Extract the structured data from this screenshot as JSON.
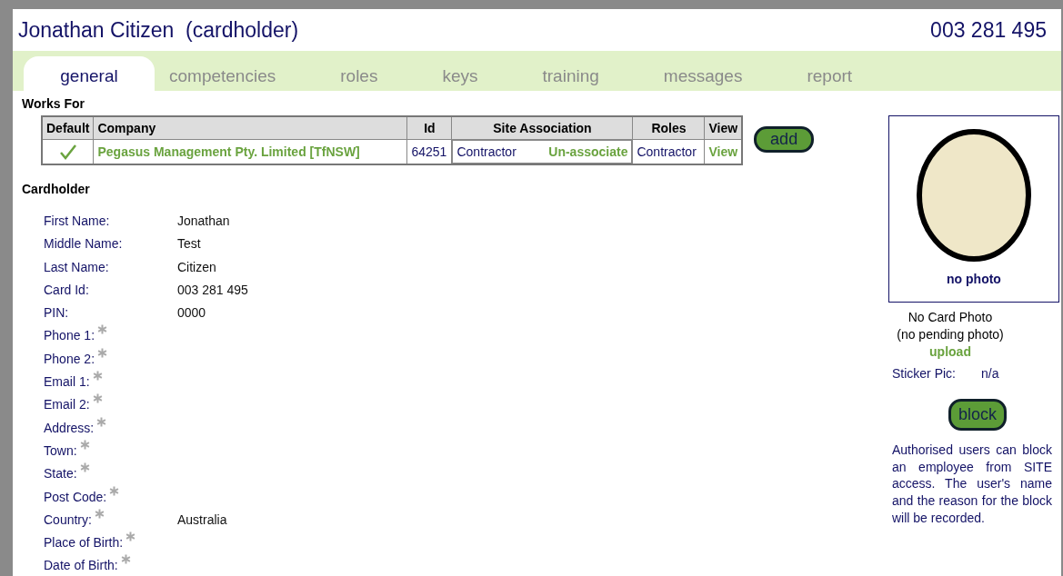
{
  "header": {
    "title": "Jonathan Citizen  (cardholder)",
    "card_number": "003 281 495"
  },
  "tabs": [
    {
      "label": "general",
      "selected": true
    },
    {
      "label": "competencies",
      "selected": false
    },
    {
      "label": "roles",
      "selected": false
    },
    {
      "label": "keys",
      "selected": false
    },
    {
      "label": "training",
      "selected": false
    },
    {
      "label": "messages",
      "selected": false
    },
    {
      "label": "report",
      "selected": false
    }
  ],
  "works_for": {
    "heading": "Works For",
    "columns": [
      "Default",
      "Company",
      "Id",
      "Site Association",
      "Roles",
      "View"
    ],
    "rows": [
      {
        "default": true,
        "company": "Pegasus Management Pty. Limited [TfNSW]",
        "id": "64251",
        "site_association": "Contractor",
        "site_action": "Un-associate",
        "roles": "Contractor",
        "view": "View"
      }
    ],
    "add_button": "add"
  },
  "cardholder": {
    "heading": "Cardholder",
    "fields": [
      {
        "label": "First Name:",
        "value": "Jonathan",
        "required": false
      },
      {
        "label": "Middle Name:",
        "value": "Test",
        "required": false
      },
      {
        "label": "Last Name:",
        "value": "Citizen",
        "required": false
      },
      {
        "label": "Card Id:",
        "value": "003 281 495",
        "required": false
      },
      {
        "label": "PIN:",
        "value": "0000",
        "required": false
      },
      {
        "label": "Phone 1:",
        "required": true
      },
      {
        "label": "Phone 2:",
        "required": true
      },
      {
        "label": "Email 1:",
        "required": true
      },
      {
        "label": "Email 2:",
        "required": true
      },
      {
        "label": "Address:",
        "required": true
      },
      {
        "label": "Town:",
        "required": true
      },
      {
        "label": "State:",
        "required": true
      },
      {
        "label": "Post Code:",
        "required": true
      },
      {
        "label": "Country:",
        "value": "Australia",
        "required": true
      },
      {
        "label": "Place of Birth:",
        "required": true
      },
      {
        "label": "Date of Birth:",
        "required": true
      }
    ]
  },
  "photo": {
    "caption": "no photo",
    "status": "No Card Photo",
    "pending": "(no pending photo)",
    "upload_link": "upload",
    "sticker_label": "Sticker Pic:",
    "sticker_value": "n/a"
  },
  "block": {
    "button": "block",
    "note": "Authorised users can block an employee from SITE access. The user's name and the reason for the block will be recorded."
  }
}
